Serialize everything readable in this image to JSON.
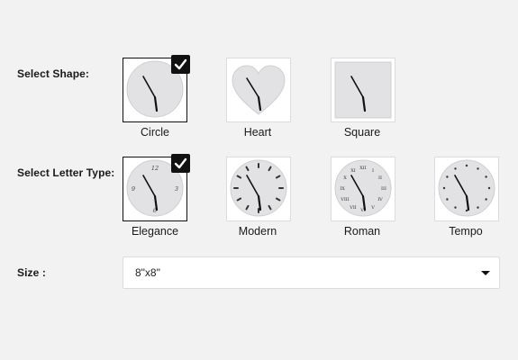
{
  "shape": {
    "label": "Select Shape:",
    "options": [
      {
        "label": "Circle",
        "selected": true
      },
      {
        "label": "Heart",
        "selected": false
      },
      {
        "label": "Square",
        "selected": false
      }
    ]
  },
  "letter_type": {
    "label": "Select Letter Type:",
    "options": [
      {
        "label": "Elegance",
        "selected": true
      },
      {
        "label": "Modern",
        "selected": false
      },
      {
        "label": "Roman",
        "selected": false
      },
      {
        "label": "Tempo",
        "selected": false
      }
    ]
  },
  "size": {
    "label": "Size :",
    "value": "8\"x8\""
  },
  "colors": {
    "background": "#f2f2f2",
    "clock_face": "#e2e2e4",
    "selected_border": "#111111",
    "check_badge": "#111111"
  }
}
